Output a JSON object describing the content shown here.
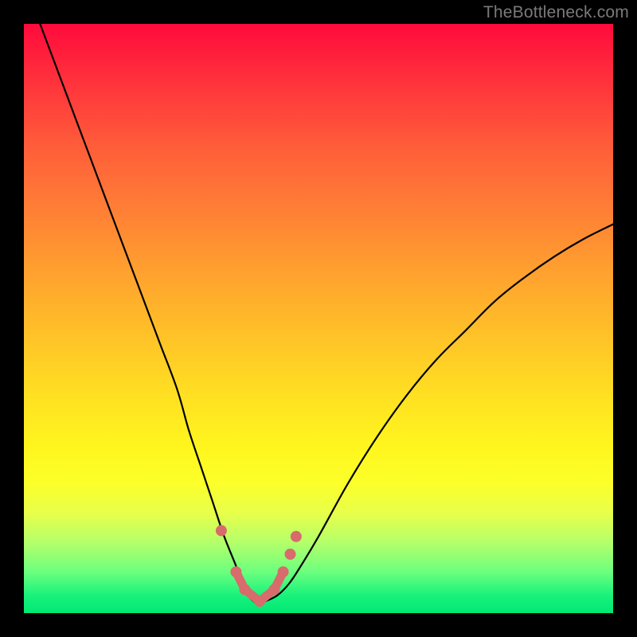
{
  "watermark": "TheBottleneck.com",
  "colors": {
    "background": "#000000",
    "curve": "#000000",
    "marker": "#d86b6b",
    "gradient_top": "#ff0a3c",
    "gradient_bottom": "#00e874"
  },
  "chart_data": {
    "type": "line",
    "title": "",
    "xlabel": "",
    "ylabel": "",
    "xlim": [
      0,
      100
    ],
    "ylim": [
      0,
      100
    ],
    "series": [
      {
        "name": "bottleneck-curve",
        "x": [
          2,
          5,
          8,
          11,
          14,
          17,
          20,
          23,
          26,
          28,
          30,
          32,
          34,
          36,
          37,
          38,
          39,
          40,
          41,
          43,
          45,
          47,
          50,
          55,
          60,
          65,
          70,
          75,
          80,
          85,
          90,
          95,
          100
        ],
        "y": [
          102,
          94,
          86,
          78,
          70,
          62,
          54,
          46,
          38,
          31,
          25,
          19,
          13,
          8,
          5,
          3,
          2,
          1.5,
          2,
          3,
          5,
          8,
          13,
          22,
          30,
          37,
          43,
          48,
          53,
          57,
          60.5,
          63.5,
          66
        ]
      }
    ],
    "markers": {
      "name": "highlight-markers",
      "x": [
        33.5,
        36.0,
        37.5,
        40.0,
        42.5,
        44.0,
        45.2,
        46.2
      ],
      "y": [
        14,
        7,
        4,
        2,
        4,
        7,
        10,
        13
      ]
    }
  }
}
